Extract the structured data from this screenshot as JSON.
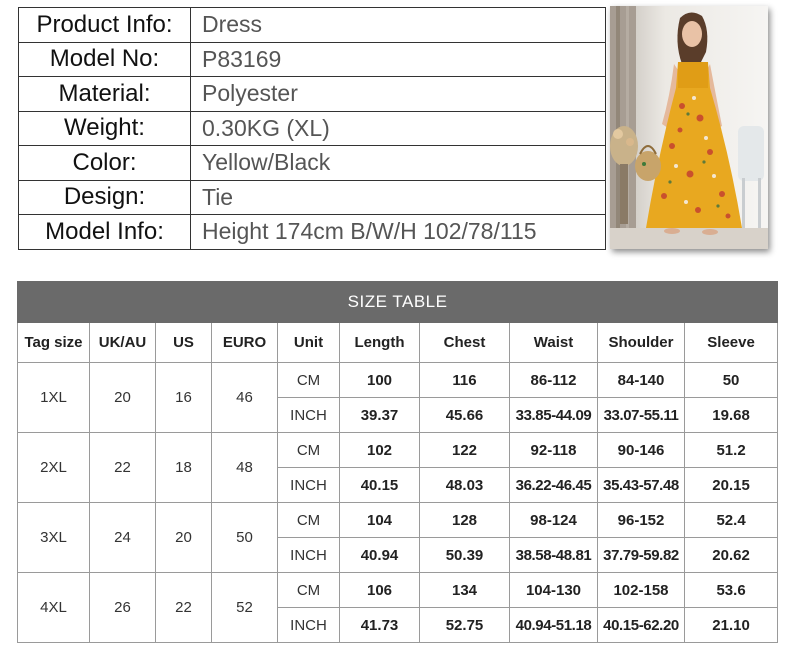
{
  "product_info": [
    {
      "label": "Product Info:",
      "value": "Dress"
    },
    {
      "label": "Model No:",
      "value": "P83169"
    },
    {
      "label": "Material:",
      "value": "Polyester"
    },
    {
      "label": "Weight:",
      "value": "0.30KG (XL)"
    },
    {
      "label": "Color:",
      "value": "Yellow/Black"
    },
    {
      "label": "Design:",
      "value": "Tie"
    },
    {
      "label": "Model Info:",
      "value": "Height 174cm  B/W/H 102/78/115"
    }
  ],
  "colors": {
    "dress": "#e8a820",
    "title_bar": "#6a6a6a",
    "border": "#9a9a9a"
  },
  "size_table": {
    "title": "SIZE TABLE",
    "headers": [
      "Tag size",
      "UK/AU",
      "US",
      "EURO",
      "Unit",
      "Length",
      "Chest",
      "Waist",
      "Shoulder",
      "Sleeve"
    ],
    "sizes": [
      {
        "tag": "1XL",
        "uk": "20",
        "us": "16",
        "euro": "46",
        "cm": {
          "unit": "CM",
          "length": "100",
          "chest": "116",
          "waist": "86-112",
          "shoulder": "84-140",
          "sleeve": "50"
        },
        "inch": {
          "unit": "INCH",
          "length": "39.37",
          "chest": "45.66",
          "waist": "33.85-44.09",
          "shoulder": "33.07-55.11",
          "sleeve": "19.68"
        }
      },
      {
        "tag": "2XL",
        "uk": "22",
        "us": "18",
        "euro": "48",
        "cm": {
          "unit": "CM",
          "length": "102",
          "chest": "122",
          "waist": "92-118",
          "shoulder": "90-146",
          "sleeve": "51.2"
        },
        "inch": {
          "unit": "INCH",
          "length": "40.15",
          "chest": "48.03",
          "waist": "36.22-46.45",
          "shoulder": "35.43-57.48",
          "sleeve": "20.15"
        }
      },
      {
        "tag": "3XL",
        "uk": "24",
        "us": "20",
        "euro": "50",
        "cm": {
          "unit": "CM",
          "length": "104",
          "chest": "128",
          "waist": "98-124",
          "shoulder": "96-152",
          "sleeve": "52.4"
        },
        "inch": {
          "unit": "INCH",
          "length": "40.94",
          "chest": "50.39",
          "waist": "38.58-48.81",
          "shoulder": "37.79-59.82",
          "sleeve": "20.62"
        }
      },
      {
        "tag": "4XL",
        "uk": "26",
        "us": "22",
        "euro": "52",
        "cm": {
          "unit": "CM",
          "length": "106",
          "chest": "134",
          "waist": "104-130",
          "shoulder": "102-158",
          "sleeve": "53.6"
        },
        "inch": {
          "unit": "INCH",
          "length": "41.73",
          "chest": "52.75",
          "waist": "40.94-51.18",
          "shoulder": "40.15-62.20",
          "sleeve": "21.10"
        }
      }
    ]
  }
}
